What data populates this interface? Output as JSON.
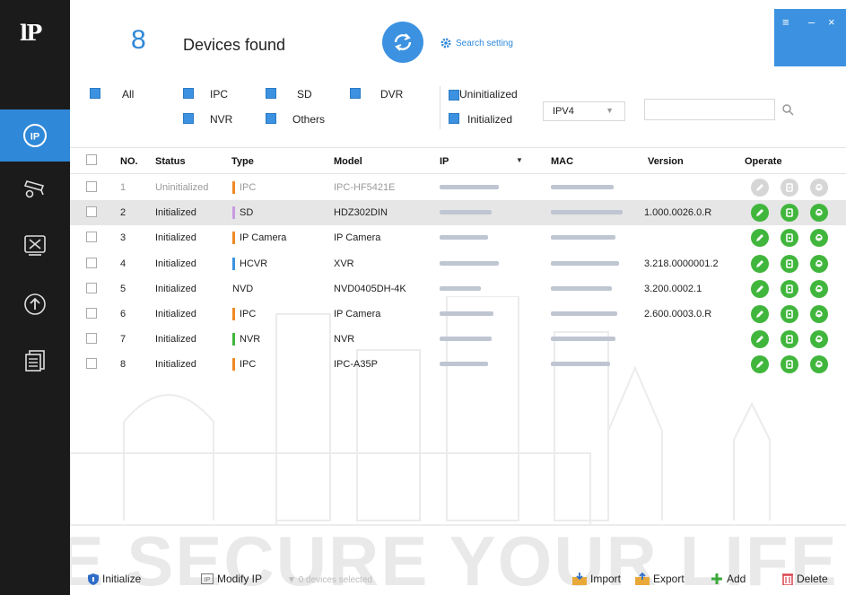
{
  "app": {
    "logo": "lP"
  },
  "colors": {
    "accent": "#3c92e0",
    "sidebar": "#1b1b1b",
    "op_green": "#41b63d"
  },
  "header": {
    "count": "8",
    "found_label": "Devices found",
    "search_setting": "Search setting"
  },
  "window": {
    "menu_icon": "≡",
    "minimize": "–",
    "close": "×"
  },
  "filters": {
    "all": "All",
    "ipc": "IPC",
    "sd": "SD",
    "dvr": "DVR",
    "nvr": "NVR",
    "others": "Others",
    "uninitialized": "Uninitialized",
    "initialized": "Initialized",
    "ip_version": "IPV4",
    "search_value": ""
  },
  "table": {
    "columns": {
      "no": "NO.",
      "status": "Status",
      "type": "Type",
      "model": "Model",
      "ip": "IP",
      "mac": "MAC",
      "version": "Version",
      "operate": "Operate"
    },
    "rows": [
      {
        "no": "1",
        "status": "Uninitialized",
        "type": "IPC",
        "type_color": "#f08a24",
        "model": "IPC-HF5421E",
        "version": "",
        "dim": true
      },
      {
        "no": "2",
        "status": "Initialized",
        "type": "SD",
        "type_color": "#c79be0",
        "model": "HDZ302DIN",
        "version": "1.000.0026.0.R"
      },
      {
        "no": "3",
        "status": "Initialized",
        "type": "IP Camera",
        "type_color": "#f08a24",
        "model": "IP Camera",
        "version": ""
      },
      {
        "no": "4",
        "status": "Initialized",
        "type": "HCVR",
        "type_color": "#3c92e0",
        "model": "XVR",
        "version": "3.218.0000001.2"
      },
      {
        "no": "5",
        "status": "Initialized",
        "type": "NVD",
        "type_color": "",
        "model": "NVD0405DH-4K",
        "version": "3.200.0002.1"
      },
      {
        "no": "6",
        "status": "Initialized",
        "type": "IPC",
        "type_color": "#f08a24",
        "model": "IP Camera",
        "version": "2.600.0003.0.R"
      },
      {
        "no": "7",
        "status": "Initialized",
        "type": "NVR",
        "type_color": "#41b63d",
        "model": "NVR",
        "version": ""
      },
      {
        "no": "8",
        "status": "Initialized",
        "type": "IPC",
        "type_color": "#f08a24",
        "model": "IPC-A35P",
        "version": ""
      }
    ]
  },
  "footer": {
    "initialize": "Initialize",
    "modify_ip": "Modify IP",
    "devices_selected": "0   devices selected",
    "import": "Import",
    "export": "Export",
    "add": "Add",
    "delete": "Delete"
  },
  "watermark": "WE SECURE YOUR LIFE"
}
